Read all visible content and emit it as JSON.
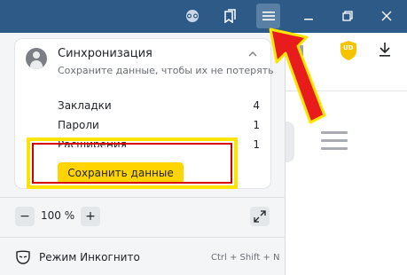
{
  "titlebar": {
    "buttons": [
      {
        "name": "profile-mask",
        "glyph": "◎"
      },
      {
        "name": "collections",
        "glyph": "❐"
      },
      {
        "name": "main-menu",
        "glyph": "≡"
      },
      {
        "name": "minimize",
        "glyph": "—"
      },
      {
        "name": "restore",
        "glyph": "❐"
      },
      {
        "name": "close",
        "glyph": "✕"
      }
    ]
  },
  "toolbar": {
    "extension_badge": "UD",
    "download_glyph": "⭳"
  },
  "menu": {
    "sync": {
      "title": "Синхронизация",
      "subtitle": "Сохраните данные, чтобы их не потерять",
      "rows": [
        {
          "label": "Закладки",
          "value": "4"
        },
        {
          "label": "Пароли",
          "value": "1"
        },
        {
          "label": "Расширения",
          "value": "1"
        }
      ],
      "save_button": "Сохранить данные"
    },
    "zoom": {
      "minus": "−",
      "value": "100 %",
      "plus": "+"
    },
    "incognito": {
      "label": "Режим Инкогнито",
      "shortcut": "Ctrl + Shift + N"
    }
  },
  "colors": {
    "titlebar": "#2d5a86",
    "accent_yellow": "#ffd400",
    "annotation_red": "#d40000"
  }
}
